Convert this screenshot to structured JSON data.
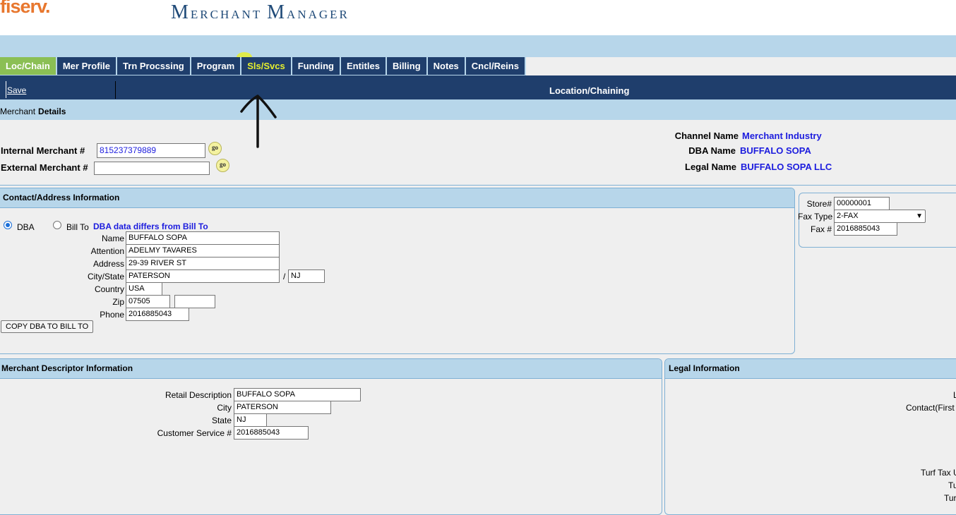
{
  "brand": {
    "logo": "fiserv.",
    "title_first": "M",
    "title_rest1": "ERCHANT",
    "title_second": "M",
    "title_rest2": "ANAGER"
  },
  "tabs": [
    {
      "label": "Loc/Chain"
    },
    {
      "label": "Mer Profile"
    },
    {
      "label": "Trn Procssing"
    },
    {
      "label": "Program"
    },
    {
      "label": "Sls/Svcs"
    },
    {
      "label": "Funding"
    },
    {
      "label": "Entitles"
    },
    {
      "label": "Billing"
    },
    {
      "label": "Notes"
    },
    {
      "label": "Cncl/Reins"
    }
  ],
  "toolbar": {
    "save_label": "Save",
    "section_title": "Location/Chaining"
  },
  "details": {
    "heading_1": "Merchant",
    "heading_2": "Details",
    "internal_label": "Internal Merchant #",
    "internal_value": "815237379889",
    "external_label": "External Merchant #",
    "external_value": "",
    "go_label": "go",
    "channel_label": "Channel Name",
    "channel_value": "Merchant Industry",
    "dba_label": "DBA Name",
    "dba_value": "BUFFALO SOPA",
    "legal_label": "Legal Name",
    "legal_value": "BUFFALO SOPA LLC"
  },
  "contact": {
    "title": "Contact/Address Information",
    "radio_dba": "DBA",
    "radio_billto": "Bill To",
    "diff_note": "DBA data differs from Bill To",
    "name_label": "Name",
    "name": "BUFFALO SOPA",
    "attention_label": "Attention",
    "attention": "ADELMY TAVARES",
    "address_label": "Address",
    "address": "29-39 RIVER ST",
    "city_label": "City/State",
    "city": "PATERSON",
    "slash": "/",
    "state": "NJ",
    "country_label": "Country",
    "country": "USA",
    "zip_label": "Zip",
    "zip": "07505",
    "zip_ext": "",
    "phone_label": "Phone",
    "phone": "2016885043",
    "copy_button": "COPY DBA TO BILL TO"
  },
  "store": {
    "store_label": "Store#",
    "store": "00000001",
    "fax_type_label": "Fax Type",
    "fax_type": "2-FAX",
    "fax_label": "Fax #",
    "fax": "2016885043"
  },
  "descriptor": {
    "title": "Merchant Descriptor Information",
    "retail_label": "Retail Description",
    "retail": "BUFFALO SOPA",
    "city_label": "City",
    "city": "PATERSON",
    "state_label": "State",
    "state": "NJ",
    "cs_label": "Customer Service #",
    "cs": "2016885043"
  },
  "legal": {
    "title": "Legal Information",
    "row1": "L",
    "row2": "Contact(First M",
    "row3": "Turf Tax U",
    "row4": "Tu",
    "row5": "Tur"
  },
  "annotation": {
    "arrow_icon": "up-arrow-icon"
  },
  "colors": {
    "navy": "#1f3e6c",
    "lightblue": "#b7d6ea",
    "active_tab": "#8bbf54",
    "highlight": "#e6ef2e",
    "link_blue": "#1c1cde",
    "logo_orange": "#e8772e"
  }
}
